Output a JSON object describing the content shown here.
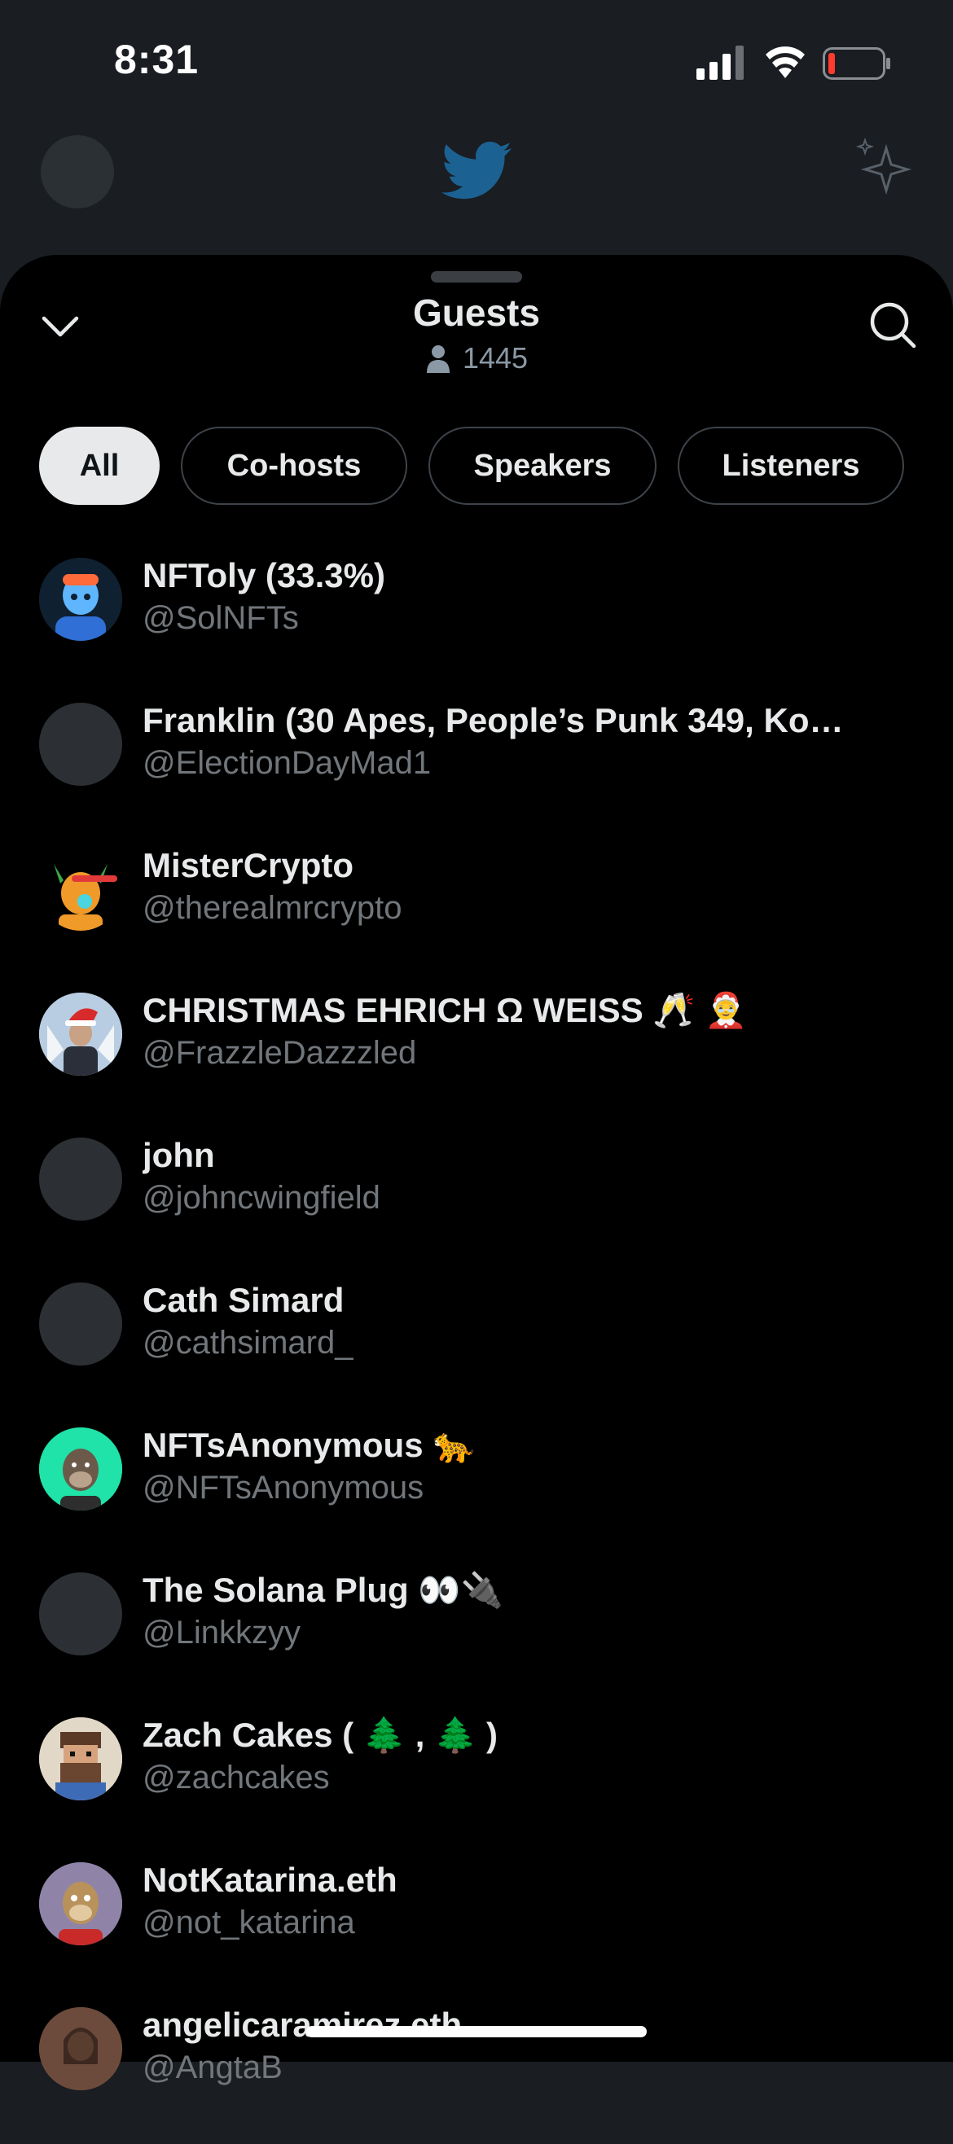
{
  "status_bar": {
    "time": "8:31"
  },
  "sheet": {
    "title": "Guests",
    "listener_count": "1445",
    "filters": [
      {
        "label": "All",
        "active": true
      },
      {
        "label": "Co-hosts",
        "active": false
      },
      {
        "label": "Speakers",
        "active": false
      },
      {
        "label": "Listeners",
        "active": false
      }
    ],
    "guests": [
      {
        "name": "NFToly (33.3%)",
        "handle": "@SolNFTs",
        "avatar": "blue-robot-avatar"
      },
      {
        "name": "Franklin (30 Apes, People’s Punk 349, Ko…",
        "handle": "@ElectionDayMad1",
        "avatar": "default-avatar"
      },
      {
        "name": "MisterCrypto",
        "handle": "@therealmrcrypto",
        "avatar": "orange-character-avatar"
      },
      {
        "name": "CHRISTMAS EHRICH Ω WEISS 🥂 🤶",
        "handle": "@FrazzleDazzzled",
        "avatar": "santa-hat-photo-avatar"
      },
      {
        "name": "john",
        "handle": "@johncwingfield",
        "avatar": "default-avatar"
      },
      {
        "name": "Cath Simard",
        "handle": "@cathsimard_",
        "avatar": "default-avatar"
      },
      {
        "name": "NFTsAnonymous 🐆",
        "handle": "@NFTsAnonymous",
        "avatar": "teal-ape-avatar"
      },
      {
        "name": "The Solana Plug 👀🔌",
        "handle": "@Linkkzyy",
        "avatar": "default-avatar"
      },
      {
        "name": "Zach Cakes ( 🌲 , 🌲 )",
        "handle": "@zachcakes",
        "avatar": "pixel-beard-avatar"
      },
      {
        "name": "NotKatarina.eth",
        "handle": "@not_katarina",
        "avatar": "purple-ape-avatar"
      },
      {
        "name": "angelicaramirez.eth",
        "handle": "@AngtaB",
        "avatar": "photo-avatar"
      }
    ]
  },
  "colors": {
    "sheet_bg": "#000000",
    "behind_bg": "#1a1d21",
    "text_primary": "#e7e9ea",
    "text_secondary": "#71767b",
    "pill_border": "#3d4349"
  }
}
